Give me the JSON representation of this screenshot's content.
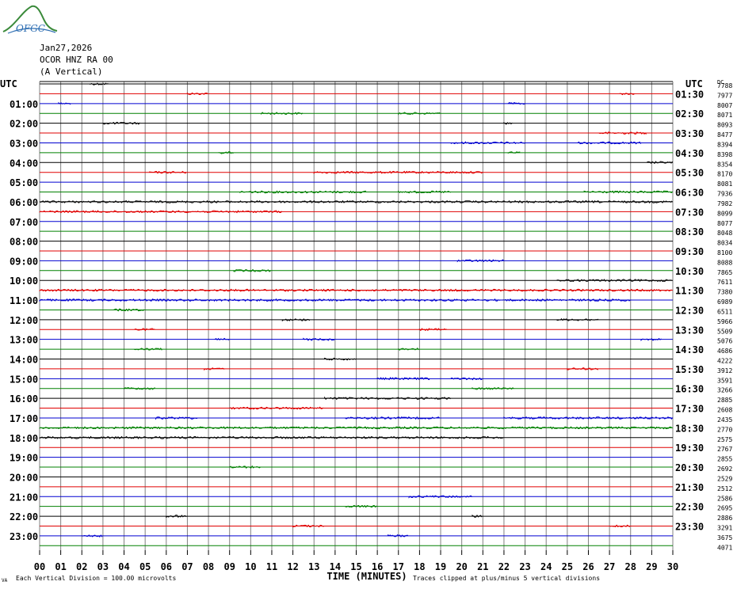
{
  "logo": {
    "text": "OFGC",
    "color": "#2f6fb3",
    "mountain_color": "#3a8a3a"
  },
  "header": {
    "date": "Jan27,2026",
    "station": "OCOR HNZ RA 00",
    "component": "(A Vertical)"
  },
  "colors": {
    "black": "#000000",
    "red": "#e00000",
    "blue": "#0000d0",
    "green": "#008000",
    "grid": "#808080"
  },
  "chart_data": {
    "type": "line",
    "title": "",
    "left_axis_label": "UTC",
    "right_axis_label": "UTC",
    "left_hours": [
      "01:00",
      "02:00",
      "03:00",
      "04:00",
      "05:00",
      "06:00",
      "07:00",
      "08:00",
      "09:00",
      "10:00",
      "11:00",
      "12:00",
      "13:00",
      "14:00",
      "15:00",
      "16:00",
      "17:00",
      "18:00",
      "19:00",
      "20:00",
      "21:00",
      "22:00",
      "23:00"
    ],
    "right_hours": [
      "01:30",
      "02:30",
      "03:30",
      "04:30",
      "05:30",
      "06:30",
      "07:30",
      "08:30",
      "09:30",
      "10:30",
      "11:30",
      "12:30",
      "13:30",
      "14:30",
      "15:30",
      "16:30",
      "17:30",
      "18:30",
      "19:30",
      "20:30",
      "21:30",
      "22:30",
      "23:30"
    ],
    "trace_color_cycle": [
      "black",
      "red",
      "blue",
      "green"
    ],
    "trace_values": [
      "7788",
      "7977",
      "8007",
      "8071",
      "8093",
      "8477",
      "8394",
      "8398",
      "8354",
      "8170",
      "8081",
      "7936",
      "7982",
      "8099",
      "8077",
      "8048",
      "8034",
      "8100",
      "8088",
      "7865",
      "7611",
      "7380",
      "6989",
      "6511",
      "5966",
      "5509",
      "5076",
      "4686",
      "4222",
      "3912",
      "3591",
      "3266",
      "2885",
      "2608",
      "2435",
      "2770",
      "2575",
      "2767",
      "2855",
      "2692",
      "2529",
      "2512",
      "2586",
      "2695",
      "2886",
      "3291",
      "3675",
      "4071"
    ],
    "x_ticks": [
      "00",
      "01",
      "02",
      "03",
      "04",
      "05",
      "06",
      "07",
      "08",
      "09",
      "10",
      "11",
      "12",
      "13",
      "14",
      "15",
      "16",
      "17",
      "18",
      "19",
      "20",
      "21",
      "22",
      "23",
      "24",
      "25",
      "26",
      "27",
      "28",
      "29",
      "30"
    ],
    "x_range": [
      0,
      30
    ],
    "xlabel": "TIME (MINUTES)",
    "footer_left": "Each Vertical Division =  100.00 microvolts",
    "footer_right": "Traces clipped at plus/minus 5 vertical divisions",
    "tiny_top_right": "DC",
    "tiny_bottom_left": "VA",
    "events": [
      {
        "trace": 0,
        "x": [
          2.4,
          3.3
        ]
      },
      {
        "trace": 1,
        "x": [
          7.0,
          8.0
        ]
      },
      {
        "trace": 1,
        "x": [
          27.5,
          28.2
        ]
      },
      {
        "trace": 2,
        "x": [
          0.9,
          1.5
        ]
      },
      {
        "trace": 2,
        "x": [
          22.2,
          23.0
        ]
      },
      {
        "trace": 3,
        "x": [
          10.5,
          12.5
        ]
      },
      {
        "trace": 3,
        "x": [
          17.0,
          19.0
        ]
      },
      {
        "trace": 4,
        "x": [
          3.0,
          4.8
        ]
      },
      {
        "trace": 4,
        "x": [
          22.0,
          22.4
        ]
      },
      {
        "trace": 5,
        "x": [
          26.5,
          28.8
        ]
      },
      {
        "trace": 6,
        "x": [
          19.5,
          23.0
        ]
      },
      {
        "trace": 6,
        "x": [
          25.5,
          28.5
        ]
      },
      {
        "trace": 7,
        "x": [
          8.5,
          9.2
        ]
      },
      {
        "trace": 7,
        "x": [
          22.2,
          22.8
        ]
      },
      {
        "trace": 8,
        "x": [
          28.8,
          30.0
        ]
      },
      {
        "trace": 9,
        "x": [
          5.2,
          7.0
        ]
      },
      {
        "trace": 9,
        "x": [
          13.0,
          21.0
        ]
      },
      {
        "trace": 11,
        "x": [
          9.5,
          15.5
        ]
      },
      {
        "trace": 11,
        "x": [
          17.0,
          19.5
        ]
      },
      {
        "trace": 11,
        "x": [
          25.8,
          30.0
        ]
      },
      {
        "trace": 12,
        "x": [
          0.0,
          30.0
        ]
      },
      {
        "trace": 13,
        "x": [
          0.0,
          11.5
        ]
      },
      {
        "trace": 18,
        "x": [
          19.8,
          22.0
        ]
      },
      {
        "trace": 19,
        "x": [
          9.2,
          11.0
        ]
      },
      {
        "trace": 20,
        "x": [
          24.5,
          30.0
        ]
      },
      {
        "trace": 21,
        "x": [
          0.0,
          30.0
        ]
      },
      {
        "trace": 22,
        "x": [
          0.0,
          28.0
        ]
      },
      {
        "trace": 23,
        "x": [
          3.5,
          5.0
        ]
      },
      {
        "trace": 24,
        "x": [
          11.5,
          12.8
        ]
      },
      {
        "trace": 24,
        "x": [
          24.5,
          26.5
        ]
      },
      {
        "trace": 25,
        "x": [
          4.5,
          5.5
        ]
      },
      {
        "trace": 25,
        "x": [
          18.0,
          19.3
        ]
      },
      {
        "trace": 26,
        "x": [
          8.3,
          9.0
        ]
      },
      {
        "trace": 26,
        "x": [
          12.5,
          14.0
        ]
      },
      {
        "trace": 26,
        "x": [
          28.5,
          29.5
        ]
      },
      {
        "trace": 27,
        "x": [
          4.5,
          5.8
        ]
      },
      {
        "trace": 27,
        "x": [
          17.0,
          18.0
        ]
      },
      {
        "trace": 28,
        "x": [
          13.5,
          15.0
        ]
      },
      {
        "trace": 29,
        "x": [
          7.8,
          8.8
        ]
      },
      {
        "trace": 29,
        "x": [
          25.0,
          26.5
        ]
      },
      {
        "trace": 30,
        "x": [
          16.0,
          18.5
        ]
      },
      {
        "trace": 30,
        "x": [
          19.5,
          21.0
        ]
      },
      {
        "trace": 31,
        "x": [
          4.0,
          5.5
        ]
      },
      {
        "trace": 31,
        "x": [
          20.5,
          22.5
        ]
      },
      {
        "trace": 32,
        "x": [
          13.5,
          19.5
        ]
      },
      {
        "trace": 33,
        "x": [
          9.0,
          13.5
        ]
      },
      {
        "trace": 34,
        "x": [
          5.5,
          7.5
        ]
      },
      {
        "trace": 34,
        "x": [
          14.5,
          19.0
        ]
      },
      {
        "trace": 34,
        "x": [
          22.0,
          30.0
        ]
      },
      {
        "trace": 35,
        "x": [
          0.0,
          30.0
        ]
      },
      {
        "trace": 36,
        "x": [
          0.0,
          22.0
        ]
      },
      {
        "trace": 39,
        "x": [
          9.0,
          10.5
        ]
      },
      {
        "trace": 42,
        "x": [
          17.5,
          20.5
        ]
      },
      {
        "trace": 43,
        "x": [
          14.5,
          16.0
        ]
      },
      {
        "trace": 44,
        "x": [
          6.0,
          7.0
        ]
      },
      {
        "trace": 44,
        "x": [
          20.5,
          21.0
        ]
      },
      {
        "trace": 45,
        "x": [
          12.0,
          13.5
        ]
      },
      {
        "trace": 45,
        "x": [
          27.0,
          28.0
        ]
      },
      {
        "trace": 46,
        "x": [
          2.0,
          3.0
        ]
      },
      {
        "trace": 46,
        "x": [
          16.5,
          17.5
        ]
      }
    ]
  }
}
